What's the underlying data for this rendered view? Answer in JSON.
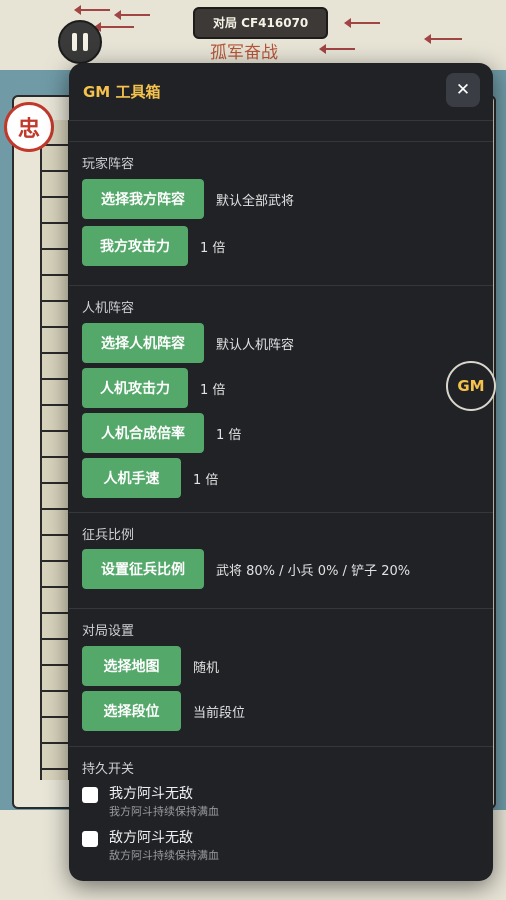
{
  "scene": {
    "match_label": "对局 CF416070",
    "title_text": "孤军奋战",
    "token_char": "忠"
  },
  "panel": {
    "title": "GM 工具箱",
    "close_glyph": "✕"
  },
  "sections": {
    "player": {
      "title": "玩家阵容",
      "select_btn": "选择我方阵容",
      "select_value": "默认全部武将",
      "attack_btn": "我方攻击力",
      "attack_value": "1 倍"
    },
    "ai": {
      "title": "人机阵容",
      "select_btn": "选择人机阵容",
      "select_value": "默认人机阵容",
      "attack_btn": "人机攻击力",
      "attack_value": "1 倍",
      "merge_btn": "人机合成倍率",
      "merge_value": "1 倍",
      "speed_btn": "人机手速",
      "speed_value": "1 倍"
    },
    "recruit": {
      "title": "征兵比例",
      "set_btn": "设置征兵比例",
      "set_value": "武将 80% / 小兵 0% / 铲子 20%"
    },
    "match": {
      "title": "对局设置",
      "map_btn": "选择地图",
      "map_value": "随机",
      "rank_btn": "选择段位",
      "rank_value": "当前段位"
    },
    "toggles": {
      "title": "持久开关",
      "items": [
        {
          "label": "我方阿斗无敌",
          "sub": "我方阿斗持续保持满血",
          "checked": false
        },
        {
          "label": "敌方阿斗无敌",
          "sub": "敌方阿斗持续保持满血",
          "checked": false
        }
      ]
    }
  },
  "gm_fab": "GM",
  "colors": {
    "accent": "#f4c24d",
    "button_green": "#54a86a",
    "panel_bg": "#202226"
  }
}
